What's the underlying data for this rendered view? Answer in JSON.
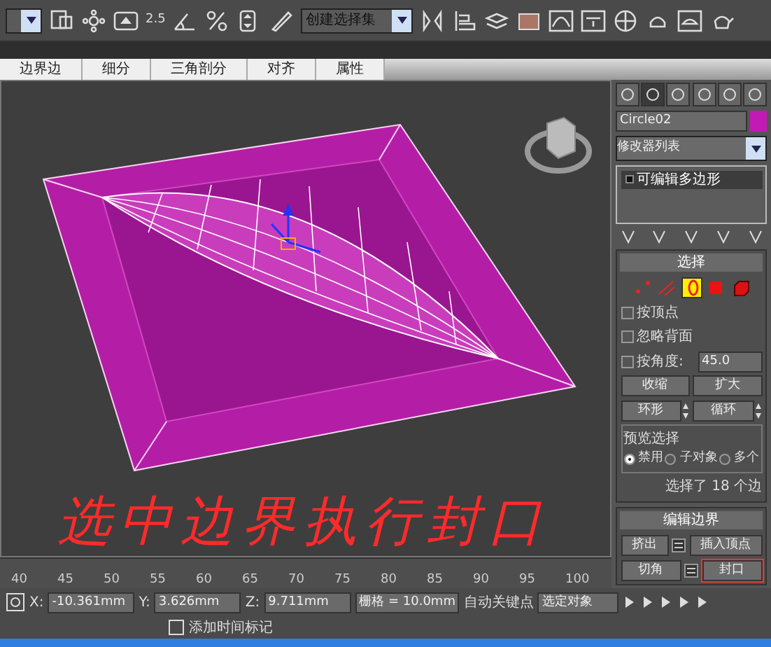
{
  "toolbar": {
    "selection_set": {
      "value": "创建选择集"
    },
    "spinner_snap": "2.5"
  },
  "ribbon_tabs": [
    {
      "label": "边界边"
    },
    {
      "label": "细分"
    },
    {
      "label": "三角剖分"
    },
    {
      "label": "对齐"
    },
    {
      "label": "属性"
    }
  ],
  "annotation": {
    "text": "选中边界执行封口"
  },
  "command_panel": {
    "object_name": "Circle02",
    "modifier_list": "修改器列表",
    "stack": [
      {
        "label": "可编辑多边形",
        "selected": true
      }
    ],
    "selection_rollout": {
      "title": "选择",
      "subobject_levels": [
        {
          "kind": "vertex",
          "selected": false
        },
        {
          "kind": "edge",
          "selected": false
        },
        {
          "kind": "border",
          "selected": true
        },
        {
          "kind": "polygon",
          "selected": false
        },
        {
          "kind": "element",
          "selected": false
        }
      ],
      "checkboxes": [
        {
          "label": "按顶点",
          "checked": false
        },
        {
          "label": "忽略背面",
          "checked": false
        },
        {
          "label": "按角度:",
          "checked": false
        }
      ],
      "angle_value": "45.0",
      "buttons": [
        {
          "label": "收缩",
          "kind": "plain"
        },
        {
          "label": "扩大",
          "kind": "plain"
        },
        {
          "label": "环形",
          "kind": "spinner"
        },
        {
          "label": "循环",
          "kind": "spinner"
        }
      ],
      "preview": {
        "title": "预览选择",
        "options": [
          {
            "label": "禁用",
            "selected": true
          },
          {
            "label": "子对象",
            "selected": false
          },
          {
            "label": "多个",
            "selected": false
          }
        ]
      },
      "status": "选择了 18 个边"
    },
    "edit_borders_rollout": {
      "title": "编辑边界",
      "buttons": [
        {
          "label": "挤出",
          "has_settings": true,
          "circled": false
        },
        {
          "label": "插入顶点",
          "has_settings": false,
          "circled": false
        },
        {
          "label": "切角",
          "has_settings": true,
          "circled": false
        },
        {
          "label": "封口",
          "has_settings": false,
          "circled": true
        }
      ]
    }
  },
  "timeline": {
    "ticks": [
      "40",
      "45",
      "50",
      "55",
      "60",
      "65",
      "70",
      "75",
      "80",
      "85",
      "90",
      "95",
      "100"
    ]
  },
  "status_bar": {
    "x_label": "X:",
    "x": "-10.361mm",
    "y_label": "Y:",
    "y": "3.626mm",
    "z_label": "Z:",
    "z": "9.711mm",
    "grid": "栅格 = 10.0mm",
    "auto_key": "自动关键点",
    "key_filter": "选定对象",
    "add_time_tag": "添加时间标记"
  }
}
